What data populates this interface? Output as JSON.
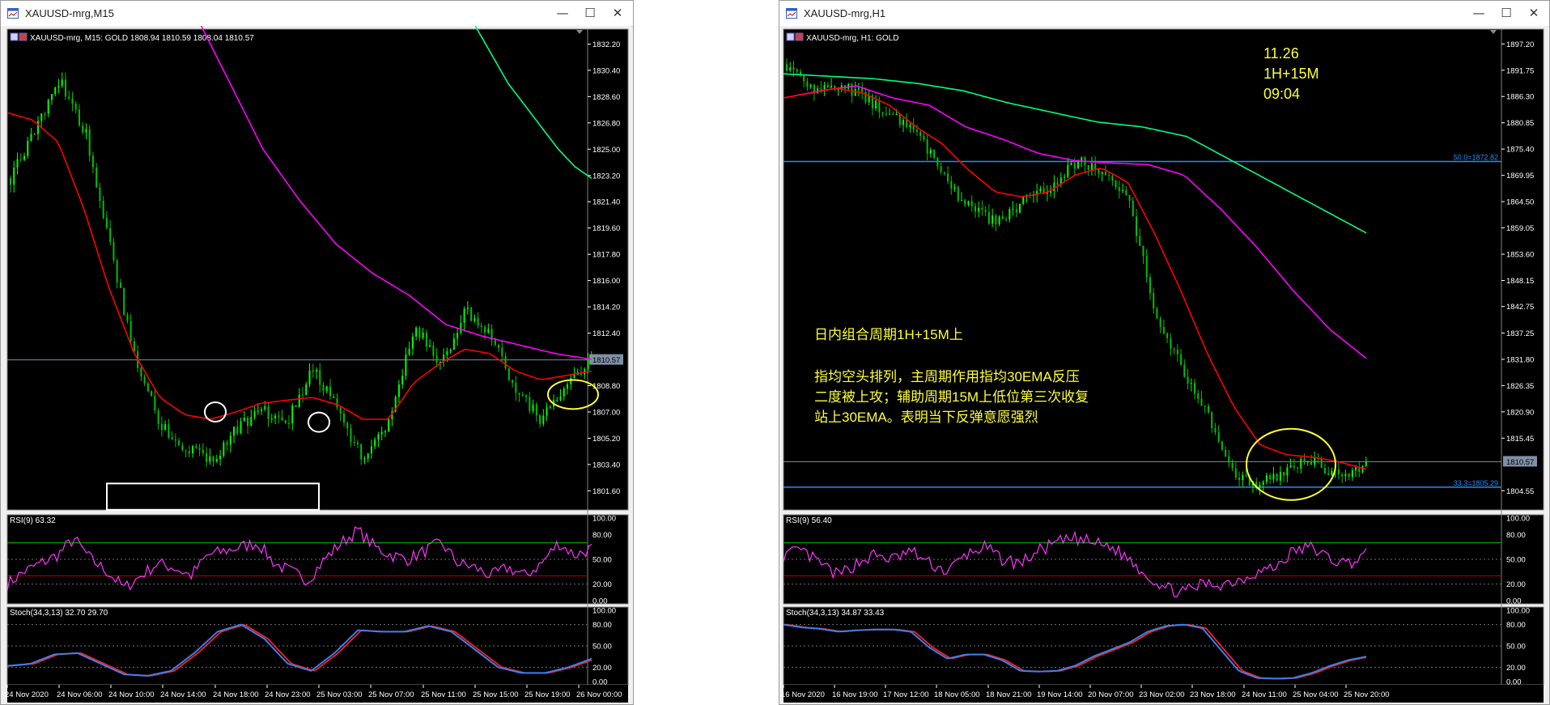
{
  "colors": {
    "background": "#000000",
    "bull_candle": "#00ff00",
    "bear_candle": "#00c000",
    "ema30": "#ff0000",
    "ma_magenta": "#ff00ff",
    "ma_green": "#00ff7f",
    "rsi_line": "#ff33ff",
    "stoch_main": "#3a7ff0",
    "stoch_signal": "#ff2020",
    "annotation_yellow": "#ffff33",
    "fib_level": "#1e90ff",
    "price_line": "#7f8fa6",
    "axis_text": "#ffffff"
  },
  "windows": [
    {
      "title": "XAUUSD-mrg,M15",
      "controls": [
        "minimize",
        "maximize",
        "close"
      ],
      "info_line": "XAUUSD-mrg, M15:  GOLD   1808.94 1810.59 1808.04 1810.57",
      "current_price_label": "1810.57",
      "price_axis": [
        "1832.20",
        "1830.40",
        "1828.60",
        "1826.80",
        "1825.00",
        "1823.20",
        "1821.40",
        "1819.60",
        "1817.80",
        "1816.00",
        "1814.20",
        "1812.40",
        "1810.57",
        "1808.80",
        "1807.00",
        "1805.20",
        "1803.40",
        "1801.60"
      ],
      "rsi_label": "RSI(9) 63.32",
      "rsi_axis": [
        "100.00",
        "80.00",
        "50.00",
        "20.00",
        "0.00"
      ],
      "stoch_label": "Stoch(34,3,13) 32.70 29.70",
      "stoch_axis": [
        "100.00",
        "80.00",
        "50.00",
        "20.00",
        "0.00"
      ],
      "time_axis": [
        "24 Nov 2020",
        "24 Nov 06:00",
        "24 Nov 10:00",
        "24 Nov 14:00",
        "24 Nov 18:00",
        "24 Nov 23:00",
        "25 Nov 03:00",
        "25 Nov 07:00",
        "25 Nov 11:00",
        "25 Nov 15:00",
        "25 Nov 19:00",
        "26 Nov 00:00"
      ],
      "fib_levels": [],
      "texts": []
    },
    {
      "title": "XAUUSD-mrg,H1",
      "controls": [
        "minimize",
        "maximize",
        "close"
      ],
      "info_line": "XAUUSD-mrg, H1:  GOLD",
      "current_price_label": "1810.57",
      "price_axis": [
        "1897.20",
        "1891.75",
        "1886.30",
        "1880.85",
        "1875.40",
        "1869.95",
        "1864.50",
        "1859.05",
        "1853.60",
        "1848.15",
        "1842.75",
        "1837.25",
        "1831.80",
        "1826.35",
        "1820.90",
        "1815.45",
        "1810.57",
        "1804.55"
      ],
      "rsi_label": "RSI(9) 56.40",
      "rsi_axis": [
        "100.00",
        "80.00",
        "50.00",
        "20.00",
        "0.00"
      ],
      "stoch_label": "Stoch(34,3,13) 34.87 33.43",
      "stoch_axis": [
        "100.00",
        "80.00",
        "50.00",
        "20.00",
        "0.00"
      ],
      "time_axis": [
        "16 Nov 2020",
        "16 Nov 19:00",
        "17 Nov 12:00",
        "18 Nov 05:00",
        "18 Nov 21:00",
        "19 Nov 14:00",
        "20 Nov 07:00",
        "23 Nov 02:00",
        "23 Nov 18:00",
        "24 Nov 11:00",
        "25 Nov 04:00",
        "25 Nov 20:00"
      ],
      "fib_levels": [
        "50.0=1872.82",
        "33.3=1805.29"
      ],
      "texts": [
        "11.26",
        "1H+15M",
        "09:04",
        "日内组合周期1H+15M上",
        "指均空头排列，主周期作用指均30EMA反压",
        "二度被上攻；辅助周期15M上低位第三次收复",
        "站上30EMA。表明当下反弹意愿强烈"
      ]
    }
  ],
  "chart_data": [
    {
      "type": "candlestick",
      "symbol": "XAUUSD-mrg",
      "timeframe": "M15",
      "title": "XAUUSD-mrg, M15:  GOLD",
      "ohlc_last": {
        "open": 1808.94,
        "high": 1810.59,
        "low": 1808.04,
        "close": 1810.57
      },
      "ylim": [
        1800.4,
        1833.0
      ],
      "x": [
        "24 Nov 2020",
        "24 Nov 06:00",
        "24 Nov 10:00",
        "24 Nov 14:00",
        "24 Nov 18:00",
        "24 Nov 23:00",
        "25 Nov 03:00",
        "25 Nov 07:00",
        "25 Nov 11:00",
        "25 Nov 15:00",
        "25 Nov 19:00",
        "26 Nov 00:00"
      ],
      "close_path": [
        1823.0,
        1826.5,
        1829.5,
        1826.0,
        1818.0,
        1810.0,
        1806.0,
        1804.5,
        1803.5,
        1806.0,
        1807.0,
        1806.5,
        1810.0,
        1807.0,
        1803.5,
        1806.5,
        1813.0,
        1810.0,
        1814.0,
        1812.5,
        1808.5,
        1806.5,
        1809.0,
        1810.6
      ],
      "ema30_path": [
        1827.5,
        1827.0,
        1825.5,
        1821.0,
        1815.5,
        1811.0,
        1808.0,
        1806.8,
        1806.5,
        1807.0,
        1807.6,
        1807.8,
        1808.0,
        1807.5,
        1806.5,
        1806.5,
        1809.0,
        1810.3,
        1811.3,
        1811.0,
        1809.8,
        1809.2,
        1809.5,
        1809.8
      ],
      "magenta_ma_path": [
        1838,
        1835,
        1830,
        1825,
        1821.5,
        1818.5,
        1816.5,
        1815.0,
        1813.0,
        1812.2,
        1811.6,
        1811.0,
        1810.6
      ],
      "green_ma_path": [
        1833.5,
        1831.5,
        1829.5,
        1828.0,
        1826.5,
        1825.0,
        1823.8,
        1823.0
      ],
      "rsi": {
        "period": 9,
        "value": 63.32,
        "levels": [
          70,
          30
        ],
        "ylim": [
          0,
          100
        ],
        "path": [
          20,
          35,
          45,
          55,
          75,
          50,
          35,
          15,
          30,
          45,
          40,
          30,
          55,
          60,
          65,
          70,
          45,
          35,
          25,
          50,
          70,
          85,
          65,
          55,
          50,
          60,
          70,
          45,
          40,
          30,
          40,
          30,
          45,
          70,
          55,
          63
        ]
      },
      "stoch": {
        "params": "34,3,13",
        "main": 32.7,
        "signal": 29.7,
        "levels": [
          80,
          20
        ],
        "ylim": [
          0,
          100
        ],
        "path": [
          22,
          25,
          38,
          40,
          25,
          10,
          8,
          15,
          40,
          70,
          80,
          60,
          25,
          15,
          40,
          72,
          70,
          70,
          78,
          70,
          45,
          20,
          12,
          12,
          20,
          32
        ]
      },
      "annotations": [
        {
          "shape": "ellipse",
          "color": "white",
          "x": "24 Nov 18:00",
          "y": 1807.0
        },
        {
          "shape": "ellipse",
          "color": "white",
          "x": "25 Nov 03:00",
          "y": 1806.3
        },
        {
          "shape": "ellipse",
          "color": "yellow",
          "x": "26 Nov 00:00",
          "y": 1808.2
        },
        {
          "shape": "rectangle",
          "color": "white",
          "x_range": [
            "24 Nov 10:00",
            "25 Nov 03:00"
          ],
          "y_range": [
            1800.3,
            1802.1
          ]
        }
      ]
    },
    {
      "type": "candlestick",
      "symbol": "XAUUSD-mrg",
      "timeframe": "H1",
      "title": "XAUUSD-mrg, H1:  GOLD",
      "ylim": [
        1800.9,
        1899.6
      ],
      "x": [
        "16 Nov 2020",
        "16 Nov 19:00",
        "17 Nov 12:00",
        "18 Nov 05:00",
        "18 Nov 21:00",
        "19 Nov 14:00",
        "20 Nov 07:00",
        "23 Nov 02:00",
        "23 Nov 18:00",
        "24 Nov 11:00",
        "25 Nov 04:00",
        "25 Nov 20:00"
      ],
      "close_path": [
        1893.0,
        1888.0,
        1889.0,
        1886.0,
        1882.0,
        1878.5,
        1869.0,
        1863.0,
        1860.0,
        1864.5,
        1867.0,
        1873.0,
        1871.0,
        1865.0,
        1842.0,
        1830.0,
        1820.0,
        1807.0,
        1806.0,
        1809.0,
        1811.0,
        1807.0,
        1810.57
      ],
      "ema30_path": [
        1886.0,
        1887.0,
        1888.0,
        1887.0,
        1884.5,
        1880.0,
        1876.5,
        1871.0,
        1866.5,
        1865.5,
        1866.5,
        1870.0,
        1871.5,
        1868.5,
        1858.0,
        1846.0,
        1833.0,
        1822.0,
        1814.0,
        1812.0,
        1811.5,
        1810.5,
        1809.0
      ],
      "magenta_ma_path": [
        1886.0,
        1887.5,
        1888.5,
        1886.0,
        1884.5,
        1880.0,
        1877.5,
        1874.5,
        1873.0,
        1872.5,
        1872.2,
        1870.0,
        1863.0,
        1855.0,
        1846.0,
        1838.0,
        1832.0
      ],
      "green_ma_path": [
        1891.0,
        1890.5,
        1890.0,
        1889.0,
        1887.5,
        1885.0,
        1883.0,
        1881.0,
        1880.0,
        1878.0,
        1873.0,
        1868.0,
        1863.0,
        1858.0
      ],
      "fib": [
        {
          "label": "50.0=1872.82",
          "price": 1872.82
        },
        {
          "label": "33.3=1805.29",
          "price": 1805.29
        }
      ],
      "rsi": {
        "period": 9,
        "value": 56.4,
        "levels": [
          70,
          30
        ],
        "ylim": [
          0,
          100
        ],
        "path": [
          55,
          60,
          45,
          30,
          45,
          55,
          50,
          60,
          45,
          35,
          55,
          65,
          50,
          45,
          60,
          70,
          75,
          70,
          65,
          50,
          30,
          15,
          10,
          20,
          20,
          25,
          35,
          40,
          60,
          65,
          50,
          45,
          56
        ]
      },
      "stoch": {
        "params": "34,3,13",
        "main": 34.87,
        "signal": 33.43,
        "levels": [
          80,
          20
        ],
        "ylim": [
          0,
          100
        ],
        "path": [
          80,
          76,
          74,
          70,
          72,
          73,
          73,
          70,
          48,
          32,
          38,
          38,
          30,
          15,
          14,
          15,
          22,
          35,
          45,
          55,
          70,
          78,
          80,
          75,
          45,
          15,
          5,
          4,
          5,
          12,
          22,
          30,
          35
        ]
      },
      "annotations": [
        {
          "shape": "ellipse",
          "color": "yellow",
          "x": "25 Nov 04:00",
          "y": 1810.0
        }
      ]
    }
  ]
}
